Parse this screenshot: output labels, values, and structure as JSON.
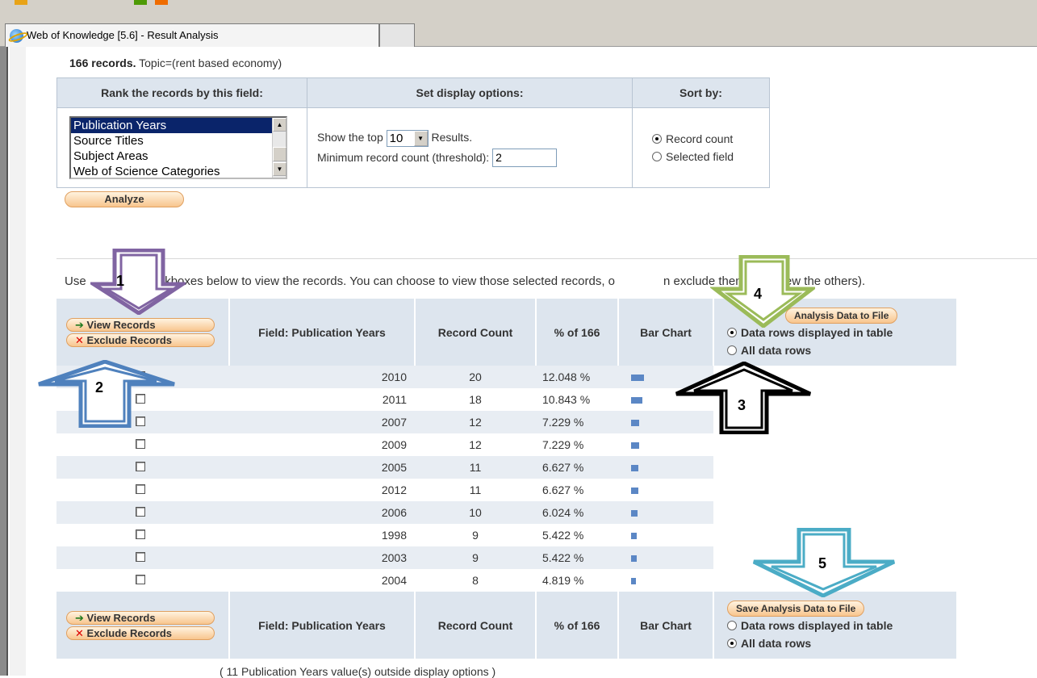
{
  "browser": {
    "tab_title": "Web of Knowledge [5.6] - Result Analysis"
  },
  "summary": {
    "count": "166 records.",
    "query": "Topic=(rent based economy)"
  },
  "options": {
    "rank_header": "Rank the records by this field:",
    "display_header": "Set display options:",
    "sort_header": "Sort by:",
    "fields": [
      "Publication Years",
      "Source Titles",
      "Subject Areas",
      "Web of Science Categories"
    ],
    "selected_field": "Publication Years",
    "show_top_prefix": "Show the top",
    "show_top_value": "10",
    "show_top_suffix": "Results.",
    "threshold_label": "Minimum record count (threshold):",
    "threshold_value": "2",
    "sort_options": [
      "Record count",
      "Selected field"
    ],
    "sort_selected": "Record count",
    "analyze_label": "Analyze"
  },
  "instruction": "Use the checkboxes below to view the records. You can choose to view those selected records, or you can exclude them (and view the others).",
  "instruction_visible": {
    "part1": "Use",
    "part2": "ckboxes below to view the records. You can choose to view those selected records, o",
    "part3": "n exclude them (and view the others)."
  },
  "results": {
    "view_records": "View Records",
    "exclude_records": "Exclude Records",
    "col_field": "Field: Publication Years",
    "col_count": "Record Count",
    "col_percent": "% of 166",
    "col_bar": "Bar Chart",
    "save_label_top_visible": "Analysis Data to File",
    "save_label": "Save Analysis Data to File",
    "save_options": [
      "Data rows displayed in table",
      "All data rows"
    ],
    "save_selected_top": "Data rows displayed in table",
    "rows": [
      {
        "year": "2010",
        "count": "20",
        "pct": "12.048 %",
        "bar": 20
      },
      {
        "year": "2011",
        "count": "18",
        "pct": "10.843 %",
        "bar": 18
      },
      {
        "year": "2007",
        "count": "12",
        "pct": "7.229 %",
        "bar": 12
      },
      {
        "year": "2009",
        "count": "12",
        "pct": "7.229 %",
        "bar": 12
      },
      {
        "year": "2005",
        "count": "11",
        "pct": "6.627 %",
        "bar": 11
      },
      {
        "year": "2012",
        "count": "11",
        "pct": "6.627 %",
        "bar": 11
      },
      {
        "year": "2006",
        "count": "10",
        "pct": "6.024 %",
        "bar": 10
      },
      {
        "year": "1998",
        "count": "9",
        "pct": "5.422 %",
        "bar": 9
      },
      {
        "year": "2003",
        "count": "9",
        "pct": "5.422 %",
        "bar": 9
      },
      {
        "year": "2004",
        "count": "8",
        "pct": "4.819 %",
        "bar": 8
      }
    ],
    "footer_visible": "( 11 Publication Years value(s) outside display options )"
  },
  "annotations": {
    "labels": [
      "1",
      "2",
      "3",
      "4",
      "5"
    ],
    "colors": {
      "1": "#8064a2",
      "2": "#4f81bd",
      "3": "#000000",
      "4": "#9bbb59",
      "5": "#4bacc6"
    }
  }
}
